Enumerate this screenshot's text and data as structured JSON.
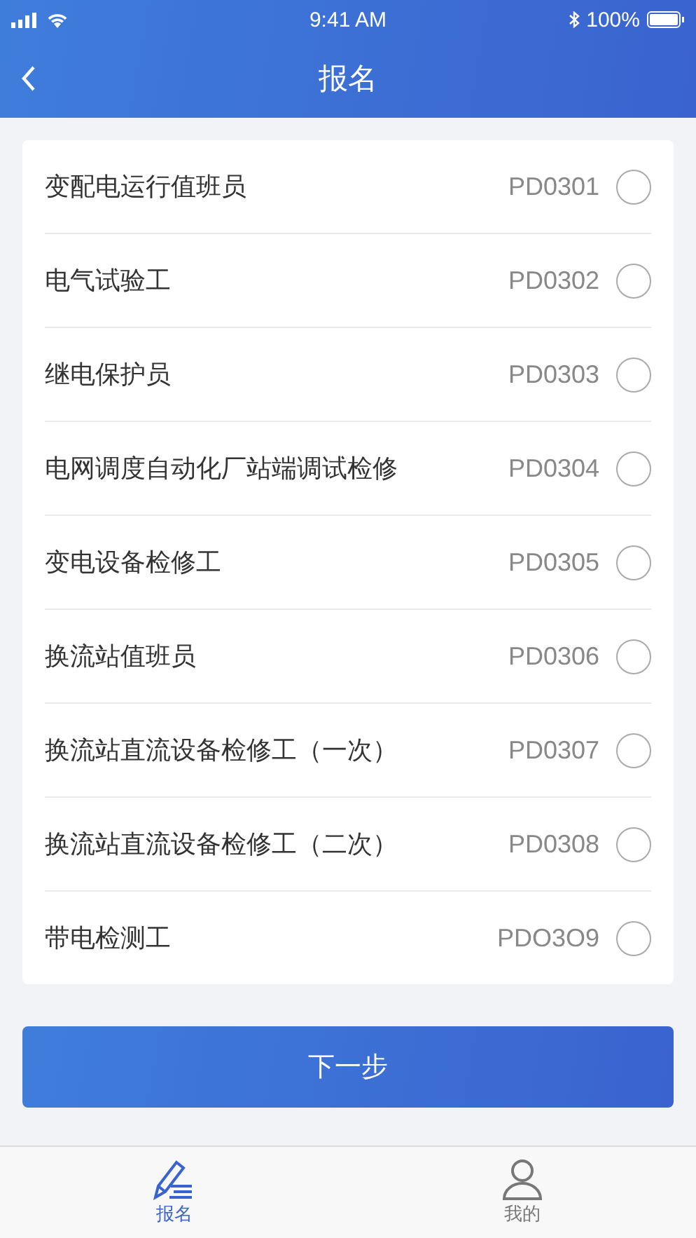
{
  "status_bar": {
    "time": "9:41 AM",
    "battery": "100%"
  },
  "nav": {
    "title": "报名"
  },
  "jobs": [
    {
      "name": "变配电运行值班员",
      "code": "PD0301",
      "selected": false
    },
    {
      "name": "电气试验工",
      "code": "PD0302",
      "selected": false
    },
    {
      "name": "继电保护员",
      "code": "PD0303",
      "selected": false
    },
    {
      "name": "电网调度自动化厂站端调试检修",
      "code": "PD0304",
      "selected": false
    },
    {
      "name": "变电设备检修工",
      "code": "PD0305",
      "selected": false
    },
    {
      "name": "换流站值班员",
      "code": "PD0306",
      "selected": false
    },
    {
      "name": "换流站直流设备检修工（一次）",
      "code": "PD0307",
      "selected": false
    },
    {
      "name": "换流站直流设备检修工（二次）",
      "code": "PD0308",
      "selected": false
    },
    {
      "name": "带电检测工",
      "code": "PDO3O9",
      "selected": false
    }
  ],
  "next_button": "下一步",
  "tabs": [
    {
      "label": "报名",
      "kind": "signup",
      "selected": true
    },
    {
      "label": "我的",
      "kind": "profile",
      "selected": false
    }
  ]
}
